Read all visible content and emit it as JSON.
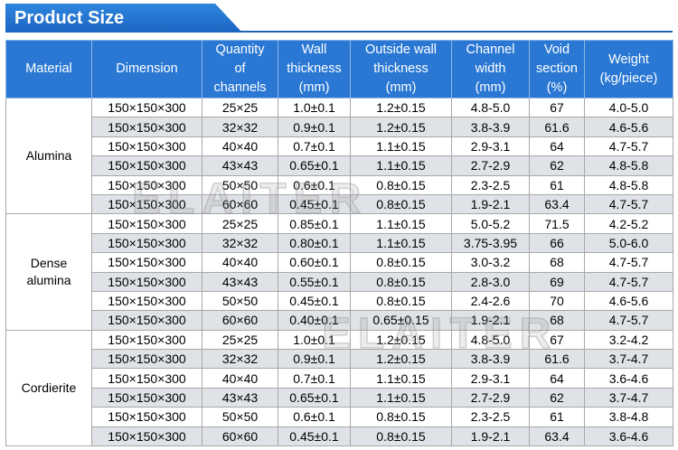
{
  "title": "Product Size",
  "watermark_text": "ELAITER",
  "columns": [
    [
      "Material"
    ],
    [
      "Dimension"
    ],
    [
      "Quantity",
      "of",
      "channels"
    ],
    [
      "Wall",
      "thickness",
      "(mm)"
    ],
    [
      "Outside wall",
      "thickness",
      "(mm)"
    ],
    [
      "Channel",
      "width",
      "(mm)"
    ],
    [
      "Void",
      "section",
      "(%)"
    ],
    [
      "Weight",
      "(kg/piece)"
    ]
  ],
  "groups": [
    {
      "material": [
        "Alumina"
      ],
      "rows": [
        [
          "150×150×300",
          "25×25",
          "1.0±0.1",
          "1.2±0.15",
          "4.8-5.0",
          "67",
          "4.0-5.0"
        ],
        [
          "150×150×300",
          "32×32",
          "0.9±0.1",
          "1.2±0.15",
          "3.8-3.9",
          "61.6",
          "4.6-5.6"
        ],
        [
          "150×150×300",
          "40×40",
          "0.7±0.1",
          "1.1±0.15",
          "2.9-3.1",
          "64",
          "4.7-5.7"
        ],
        [
          "150×150×300",
          "43×43",
          "0.65±0.1",
          "1.1±0.15",
          "2.7-2.9",
          "62",
          "4.8-5.8"
        ],
        [
          "150×150×300",
          "50×50",
          "0.6±0.1",
          "0.8±0.15",
          "2.3-2.5",
          "61",
          "4.8-5.8"
        ],
        [
          "150×150×300",
          "60×60",
          "0.45±0.1",
          "0.8±0.15",
          "1.9-2.1",
          "63.4",
          "4.7-5.7"
        ]
      ]
    },
    {
      "material": [
        "Dense",
        "alumina"
      ],
      "rows": [
        [
          "150×150×300",
          "25×25",
          "0.85±0.1",
          "1.1±0.15",
          "5.0-5.2",
          "71.5",
          "4.2-5.2"
        ],
        [
          "150×150×300",
          "32×32",
          "0.80±0.1",
          "1.1±0.15",
          "3.75-3.95",
          "66",
          "5.0-6.0"
        ],
        [
          "150×150×300",
          "40×40",
          "0.60±0.1",
          "0.8±0.15",
          "3.0-3.2",
          "68",
          "4.7-5.7"
        ],
        [
          "150×150×300",
          "43×43",
          "0.55±0.1",
          "0.8±0.15",
          "2.8-3.0",
          "69",
          "4.7-5.7"
        ],
        [
          "150×150×300",
          "50×50",
          "0.45±0.1",
          "0.8±0.15",
          "2.4-2.6",
          "70",
          "4.6-5.6"
        ],
        [
          "150×150×300",
          "60×60",
          "0.40±0.1",
          "0.65±0.15",
          "1.9-2.1",
          "68",
          "4.7-5.7"
        ]
      ]
    },
    {
      "material": [
        "Cordierite"
      ],
      "rows": [
        [
          "150×150×300",
          "25×25",
          "1.0±0.1",
          "1.2±0.15",
          "4.8-5.0",
          "67",
          "3.2-4.2"
        ],
        [
          "150×150×300",
          "32×32",
          "0.9±0.1",
          "1.2±0.15",
          "3.8-3.9",
          "61.6",
          "3.7-4.7"
        ],
        [
          "150×150×300",
          "40×40",
          "0.7±0.1",
          "1.1±0.15",
          "2.9-3.1",
          "64",
          "3.6-4.6"
        ],
        [
          "150×150×300",
          "43×43",
          "0.65±0.1",
          "1.1±0.15",
          "2.7-2.9",
          "62",
          "3.7-4.7"
        ],
        [
          "150×150×300",
          "50×50",
          "0.6±0.1",
          "0.8±0.15",
          "2.3-2.5",
          "61",
          "3.8-4.8"
        ],
        [
          "150×150×300",
          "60×60",
          "0.45±0.1",
          "0.8±0.15",
          "1.9-2.1",
          "63.4",
          "3.6-4.6"
        ]
      ]
    }
  ],
  "colors": {
    "header_bg": "#2a78d4",
    "banner_bg": "#1c66c2",
    "alt_row_bg": "#dfe2e6"
  }
}
